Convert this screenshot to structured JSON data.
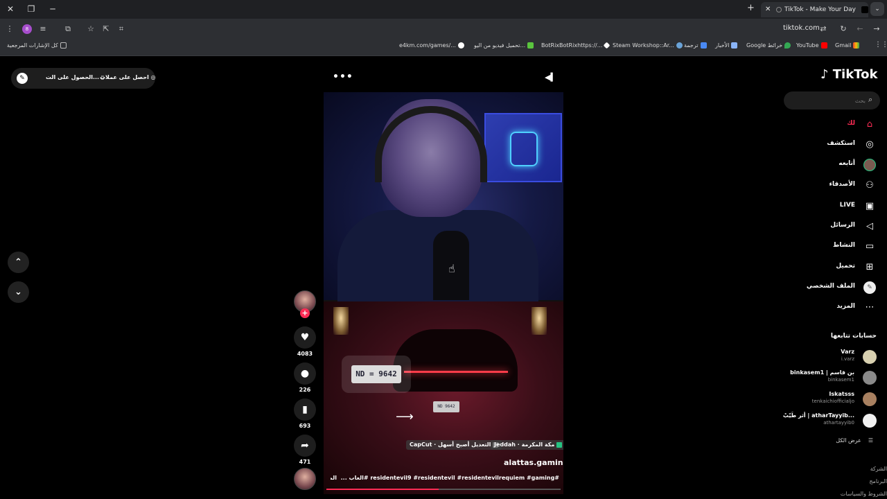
{
  "browser": {
    "tab_title": "TikTok - Make Your Day",
    "url": "tiktok.com",
    "profile_initial": "8",
    "bookmarks": [
      {
        "label": "كل الإشارات المرجعية"
      },
      {
        "label": "e4km.com/games/..."
      },
      {
        "label": "تحميل فيديو من اليو..."
      },
      {
        "label": "BotRixBotRixhttps://..."
      },
      {
        "label": "Steam Workshop::Ar..."
      },
      {
        "label": "ترجمة"
      },
      {
        "label": "الأخبار"
      },
      {
        "label": "Google خرائط"
      },
      {
        "label": "YouTube"
      },
      {
        "label": "Gmail"
      }
    ]
  },
  "getapp": {
    "label_app": "احصل على عملات",
    "label_get": "الحصول على الت..."
  },
  "video": {
    "plate_big": "ND = 9642",
    "plate_small": "ND 9642",
    "tag_location": "Jeddah · مكة المكرمة",
    "tag_capcut": "CapCut · التعديل أصبح أسهل",
    "author": "alattas.gaming",
    "caption": "#residentevil9 #residentevil #residentevilrequiem #gaming #العاب ...",
    "more": "المزيد",
    "progress": 0.48
  },
  "actions": {
    "likes": "4083",
    "comments": "226",
    "saves": "693",
    "shares": "471"
  },
  "sidebar": {
    "logo": "TikTok",
    "search_placeholder": "بحث",
    "nav": [
      {
        "label": "لك",
        "icon": "home-icon"
      },
      {
        "label": "استكشف",
        "icon": "compass-icon"
      },
      {
        "label": "أتابعه",
        "icon": "following-avatar-icon"
      },
      {
        "label": "الأصدقاء",
        "icon": "friends-icon"
      },
      {
        "label": "LIVE",
        "icon": "live-icon"
      },
      {
        "label": "الرسائل",
        "icon": "messages-icon"
      },
      {
        "label": "النشاط",
        "icon": "activity-icon"
      },
      {
        "label": "تحميل",
        "icon": "upload-icon"
      },
      {
        "label": "الملف الشخصي",
        "icon": "profile-icon"
      },
      {
        "label": "المزيد",
        "icon": "more-icon"
      }
    ],
    "following_header": "حسابات تتابعها",
    "following": [
      {
        "name": "Varz",
        "handle": "i.varz"
      },
      {
        "name": "binkasem1 | بن قاسم",
        "handle": "binkasem1"
      },
      {
        "name": "Iskatsss",
        "handle": "tenkaichiofficialjo"
      },
      {
        "name": "أثر طَيّبْ | atharTayyib...",
        "handle": "athartayyib0"
      }
    ],
    "see_all": "عرض الكل",
    "footer": [
      "الشركة",
      "البرنامج",
      "الشروط والسياسات"
    ]
  },
  "colors": {
    "accent": "#fe2c55",
    "page_bg": "#000000",
    "chrome_bg": "#2d2f33"
  }
}
